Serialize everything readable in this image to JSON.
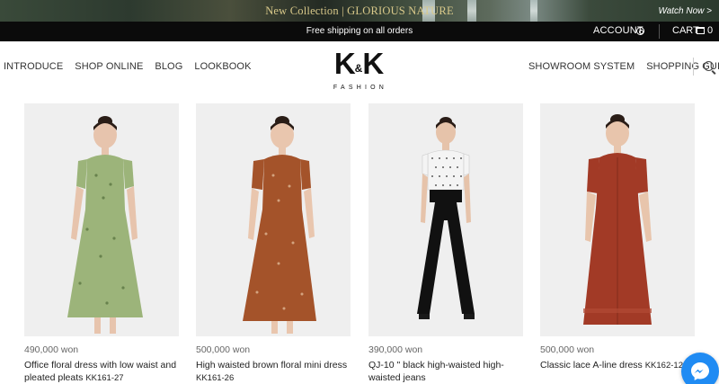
{
  "promo": {
    "text": "New Collection | GLORIOUS NATURE",
    "cta": "Watch Now >"
  },
  "topbar": {
    "shipping": "Free shipping on all orders",
    "account": "ACCOUNT",
    "cart": "CART",
    "cart_count": "0"
  },
  "brand": {
    "mark_left": "K",
    "mark_amp": "&",
    "mark_right": "K",
    "sub": "FASHION"
  },
  "nav": {
    "left": [
      "INTRODUCE",
      "SHOP ONLINE",
      "BLOG",
      "LOOKBOOK"
    ],
    "right": [
      "SHOWROOM SYSTEM",
      "SHOPPING GUIDE"
    ]
  },
  "products": [
    {
      "price": "490,000 won",
      "name": "Office floral dress with low waist and pleated pleats",
      "sku": "KK161-27",
      "color": "#9cb47a"
    },
    {
      "price": "500,000 won",
      "name": "High waisted brown floral mini dress",
      "sku": "KK161-26",
      "color": "#a4532a"
    },
    {
      "price": "390,000 won",
      "name": "QJ-10 \" black high-waisted high-waisted jeans",
      "sku": "",
      "color": "#111111"
    },
    {
      "price": "500,000 won",
      "name": "Classic lace A-line dress",
      "sku": "KK162-12",
      "color": "#a23a26"
    }
  ]
}
